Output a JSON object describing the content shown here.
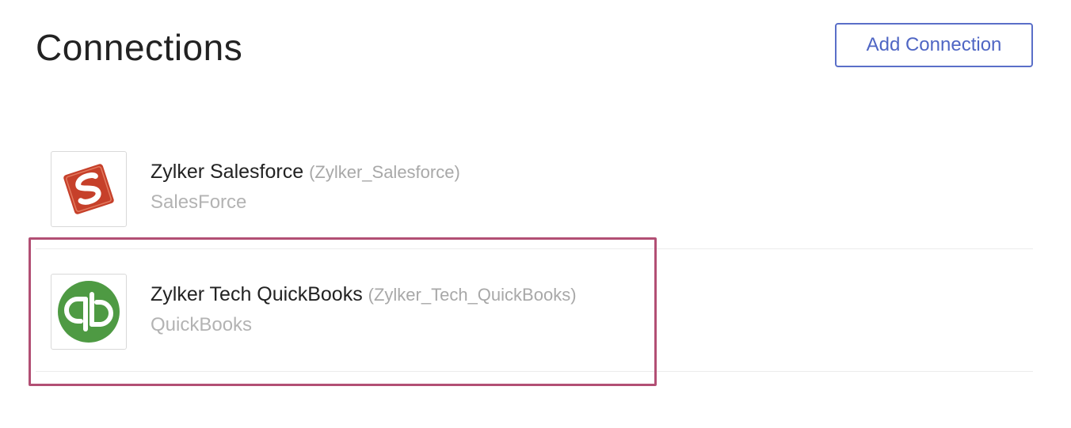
{
  "header": {
    "title": "Connections",
    "add_button_label": "Add Connection"
  },
  "connections": [
    {
      "name": "Zylker Salesforce",
      "link_name": "(Zylker_Salesforce)",
      "service": "SalesForce",
      "logo_icon": "salesforce-s-icon"
    },
    {
      "name": "Zylker Tech QuickBooks",
      "link_name": "(Zylker_Tech_QuickBooks)",
      "service": "QuickBooks",
      "logo_icon": "quickbooks-qb-icon"
    }
  ],
  "colors": {
    "accent": "#4f66c4",
    "highlight": "#b24f74",
    "salesforce_logo": "#c6402a",
    "quickbooks_logo": "#4e9a43"
  }
}
